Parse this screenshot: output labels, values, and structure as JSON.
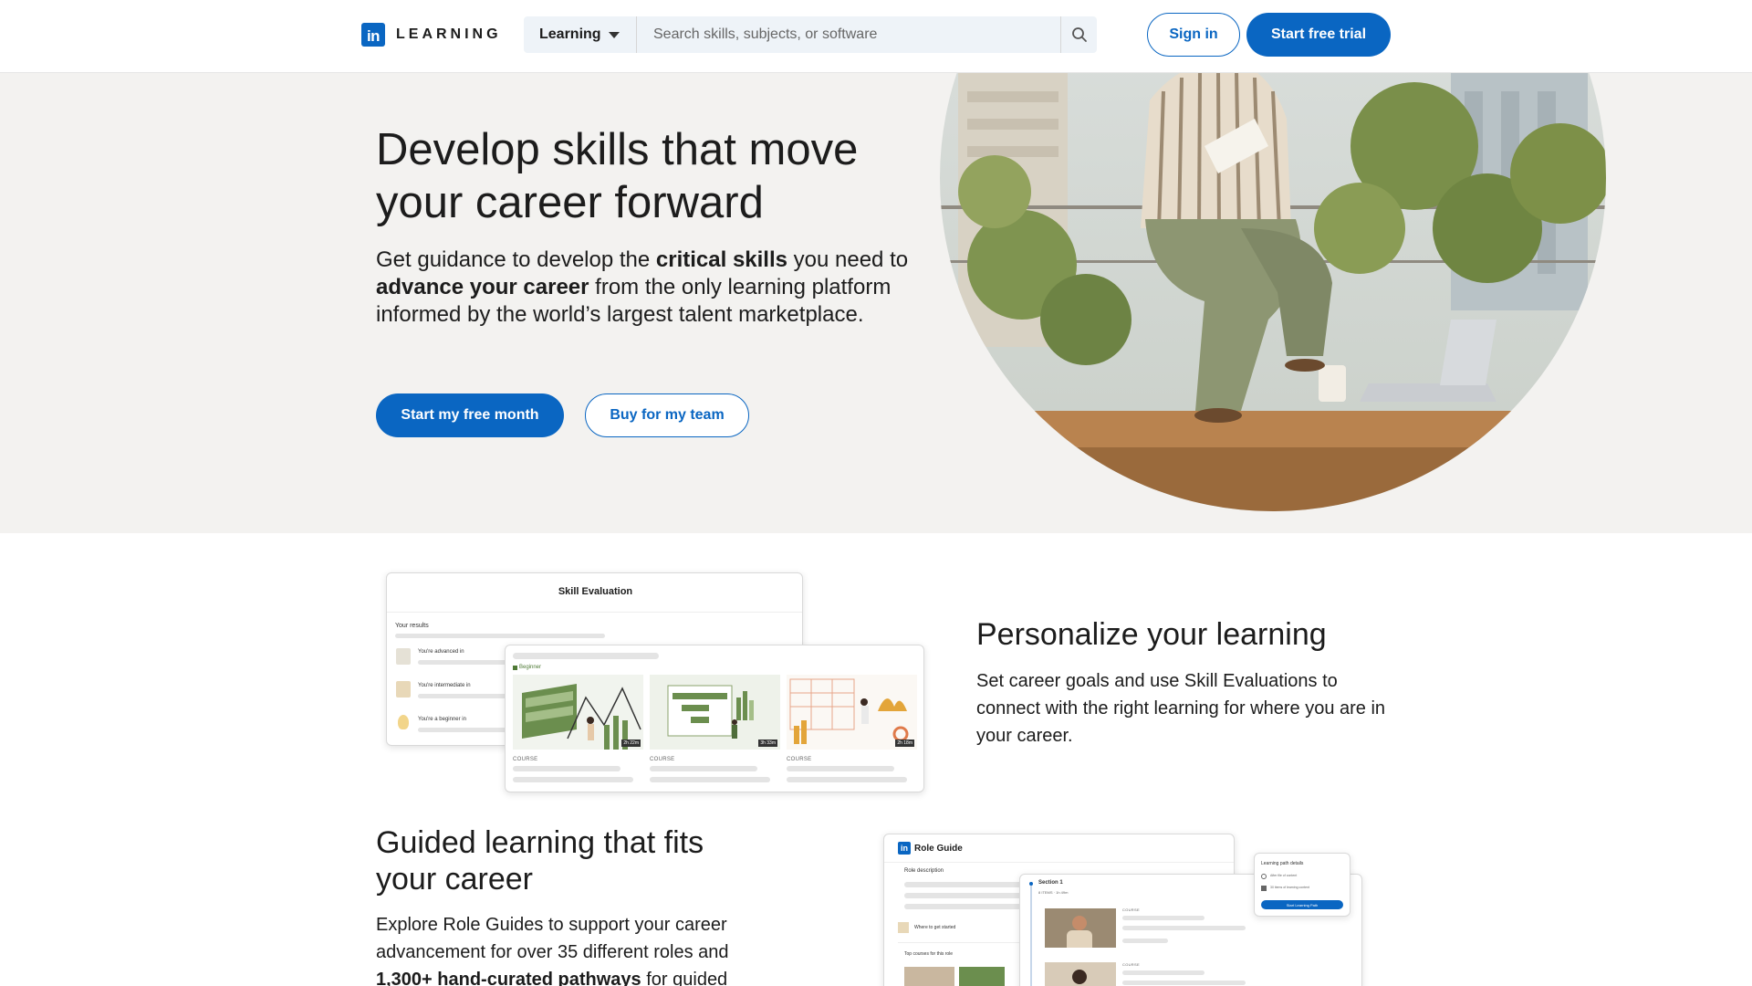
{
  "header": {
    "logo_letter": "in",
    "logo_text": "LEARNING",
    "search_category": "Learning",
    "search_placeholder": "Search skills, subjects, or software",
    "signin_label": "Sign in",
    "trial_label": "Start free trial"
  },
  "hero": {
    "title": "Develop skills that move your career forward",
    "desc_parts": {
      "p1": "Get guidance to develop the ",
      "b1": "critical skills",
      "p2": " you need to ",
      "b2": "advance your career",
      "p3": " from the only learning platform informed by the world’s largest talent marketplace."
    },
    "primary_cta": "Start my free month",
    "secondary_cta": "Buy for my team"
  },
  "personalize": {
    "title": "Personalize your learning",
    "desc": "Set career goals and use Skill Evaluations to connect with the right learning for where you are in your career.",
    "card": {
      "title": "Skill Evaluation",
      "results_label": "Your results",
      "levels": [
        "You're advanced in",
        "You're intermediate in",
        "You're a beginner in"
      ],
      "beginner_tag": "Beginner",
      "course_label": "COURSE",
      "durations": [
        "2h 22m",
        "3h 33m",
        "2h 18m"
      ]
    }
  },
  "guided": {
    "title": "Guided learning that fits your career",
    "desc_parts": {
      "p1": "Explore Role Guides to support your career advancement for over 35 different roles and ",
      "b1": "1,300+ hand-curated pathways",
      "p2": " for guided"
    },
    "card": {
      "title": "Role Guide",
      "role_description": "Role description",
      "where_to_start": "Where to get started",
      "top_courses": "Top courses for this role",
      "section": "Section 1",
      "section_meta": "8 ITEMS  ·  1h 49m",
      "course_label": "COURSE",
      "path_details_title": "Learning path details",
      "path_details_lines": [
        "After file of content",
        "30 items of learning content"
      ],
      "path_button": "Start Learning Path"
    }
  },
  "colors": {
    "brand": "#0a66c2",
    "hero_bg": "#f3f2f0",
    "chart_green": "#6b8e4e"
  }
}
